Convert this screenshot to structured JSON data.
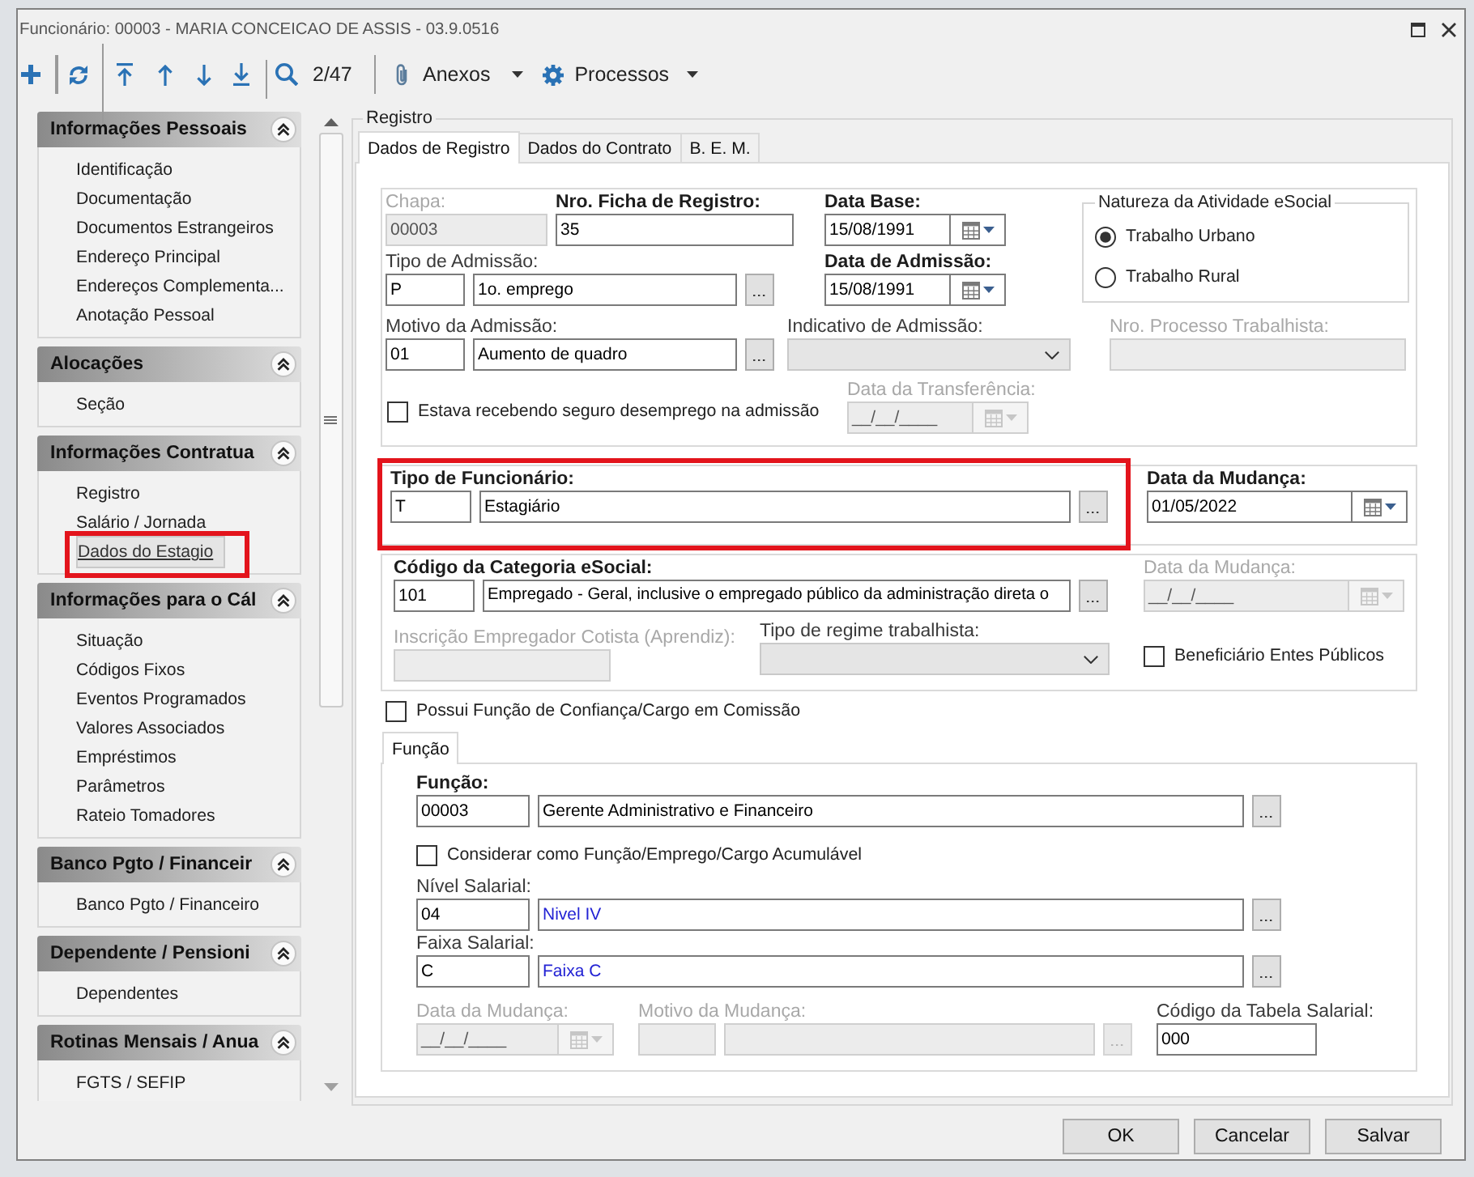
{
  "window": {
    "title": "Funcionário: 00003 - MARIA CONCEICAO DE ASSIS - 03.9.0516"
  },
  "toolbar": {
    "record_position": "2/47",
    "menus": [
      {
        "kind": "attachments",
        "label": "Anexos"
      },
      {
        "kind": "processes",
        "label": "Processos"
      }
    ]
  },
  "sidebar": {
    "groups": [
      {
        "title": "Informações Pessoais",
        "expanded": true,
        "items": [
          {
            "label": "Identificação",
            "selected": false,
            "highlighted": false
          },
          {
            "label": "Documentação",
            "selected": false,
            "highlighted": false
          },
          {
            "label": "Documentos Estrangeiros",
            "selected": false,
            "highlighted": false
          },
          {
            "label": "Endereço Principal",
            "selected": false,
            "highlighted": false
          },
          {
            "label": "Endereços Complementa...",
            "selected": false,
            "highlighted": false
          },
          {
            "label": "Anotação Pessoal",
            "selected": false,
            "highlighted": false
          }
        ]
      },
      {
        "title": "Alocações",
        "expanded": true,
        "items": [
          {
            "label": "Seção",
            "selected": false,
            "highlighted": false
          }
        ]
      },
      {
        "title": "Informações Contratua",
        "expanded": true,
        "items": [
          {
            "label": "Registro",
            "selected": false,
            "highlighted": false
          },
          {
            "label": "Salário / Jornada",
            "selected": false,
            "highlighted": false
          },
          {
            "label": "Dados do Estagio",
            "selected": true,
            "highlighted": true
          }
        ]
      },
      {
        "title": "Informações para o Cál",
        "expanded": true,
        "items": [
          {
            "label": "Situação",
            "selected": false,
            "highlighted": false
          },
          {
            "label": "Códigos Fixos",
            "selected": false,
            "highlighted": false
          },
          {
            "label": "Eventos Programados",
            "selected": false,
            "highlighted": false
          },
          {
            "label": "Valores Associados",
            "selected": false,
            "highlighted": false
          },
          {
            "label": "Empréstimos",
            "selected": false,
            "highlighted": false
          },
          {
            "label": "Parâmetros",
            "selected": false,
            "highlighted": false
          },
          {
            "label": "Rateio Tomadores",
            "selected": false,
            "highlighted": false
          }
        ]
      },
      {
        "title": "Banco Pgto / Financeir",
        "expanded": true,
        "items": [
          {
            "label": "Banco Pgto / Financeiro",
            "selected": false,
            "highlighted": false
          }
        ]
      },
      {
        "title": "Dependente / Pensioni",
        "expanded": true,
        "items": [
          {
            "label": "Dependentes",
            "selected": false,
            "highlighted": false
          }
        ]
      },
      {
        "title": "Rotinas Mensais / Anua",
        "expanded": true,
        "items": [
          {
            "label": "FGTS / SEFIP",
            "selected": false,
            "highlighted": false
          }
        ]
      }
    ]
  },
  "registro": {
    "title": "Registro",
    "tabs": [
      {
        "label": "Dados de Registro",
        "selected": true
      },
      {
        "label": "Dados do Contrato",
        "selected": false
      },
      {
        "label": "B. E. M.",
        "selected": false
      }
    ],
    "admission": {
      "chapa": {
        "label": "Chapa:",
        "value": "00003",
        "required": false,
        "disabled": true
      },
      "record_number": {
        "label": "Nro. Ficha de Registro:",
        "value": "35",
        "required": true,
        "disabled": false
      },
      "base_date": {
        "label": "Data Base:",
        "value": "15/08/1991",
        "required": true,
        "disabled": false
      },
      "admission_type": {
        "label": "Tipo de Admissão:",
        "code": "P",
        "description": "1o. emprego",
        "required": false,
        "disabled": false,
        "linked": false
      },
      "admission_date": {
        "label": "Data de Admissão:",
        "value": "15/08/1991",
        "required": true,
        "disabled": false
      },
      "activity_nature": {
        "title": "Natureza da Atividade eSocial",
        "options": [
          {
            "label": "Trabalho Urbano",
            "selected": true
          },
          {
            "label": "Trabalho Rural",
            "selected": false
          }
        ]
      },
      "admission_reason": {
        "label": "Motivo da Admissão:",
        "code": "01",
        "description": "Aumento de quadro",
        "required": false,
        "disabled": false,
        "linked": false
      },
      "admission_indicator": {
        "label": "Indicativo de Admissão:",
        "required": false,
        "disabled": false
      },
      "process_number": {
        "label": "Nro. Processo Trabalhista:",
        "required": false,
        "disabled": true
      },
      "unemployment_insurance": {
        "label": "Estava recebendo seguro desemprego na admissão",
        "checked": false
      },
      "transfer_date": {
        "label": "Data da Transferência:",
        "value": "__/__/____",
        "required": false,
        "disabled": true
      }
    },
    "employee_type": {
      "highlighted": true,
      "type": {
        "label": "Tipo de Funcionário:",
        "code": "T",
        "description": "Estagiário",
        "required": true,
        "disabled": false,
        "linked": false
      },
      "change_date": {
        "label": "Data da Mudança:",
        "value": "01/05/2022",
        "required": true,
        "disabled": false
      }
    },
    "esocial": {
      "category": {
        "label": "Código da Categoria eSocial:",
        "code": "101",
        "description": "Empregado - Geral, inclusive o empregado público da administração direta o",
        "required": true,
        "disabled": false,
        "linked": false
      },
      "change_date": {
        "label": "Data da Mudança:",
        "value": "__/__/____",
        "required": false,
        "disabled": true
      },
      "apprentice_employer": {
        "label": "Inscrição Empregador Cotista (Aprendiz):",
        "required": false,
        "disabled": true
      },
      "regime_type": {
        "label": "Tipo de regime trabalhista:",
        "required": false,
        "disabled": false
      },
      "public_entity_beneficiary": {
        "label": "Beneficiário Entes Públicos",
        "checked": false
      }
    },
    "trust_position": {
      "label": "Possui Função de Confiança/Cargo em Comissão",
      "checked": false
    },
    "function_tabs": [
      {
        "label": "Função",
        "selected": true
      }
    ],
    "function": {
      "role": {
        "label": "Função:",
        "code": "00003",
        "description": "Gerente Administrativo e Financeiro",
        "required": true,
        "disabled": false,
        "linked": false
      },
      "cumulative": {
        "label": "Considerar como Função/Emprego/Cargo Acumulável",
        "checked": false
      },
      "salary_level": {
        "label": "Nível Salarial:",
        "code": "04",
        "description": "Nivel IV",
        "required": false,
        "disabled": false,
        "linked": true
      },
      "salary_band": {
        "label": "Faixa Salarial:",
        "code": "C",
        "description": "Faixa C",
        "required": false,
        "disabled": false,
        "linked": true
      },
      "change_date": {
        "label": "Data da Mudança:",
        "value": "__/__/____",
        "required": false,
        "disabled": true
      },
      "change_reason": {
        "label": "Motivo da Mudança:",
        "required": false,
        "disabled": true
      },
      "salary_table_code": {
        "label": "Código da Tabela Salarial:",
        "value": "000",
        "required": false,
        "disabled": false
      }
    }
  },
  "buttons": [
    {
      "label": "OK"
    },
    {
      "label": "Cancelar"
    },
    {
      "label": "Salvar"
    }
  ]
}
